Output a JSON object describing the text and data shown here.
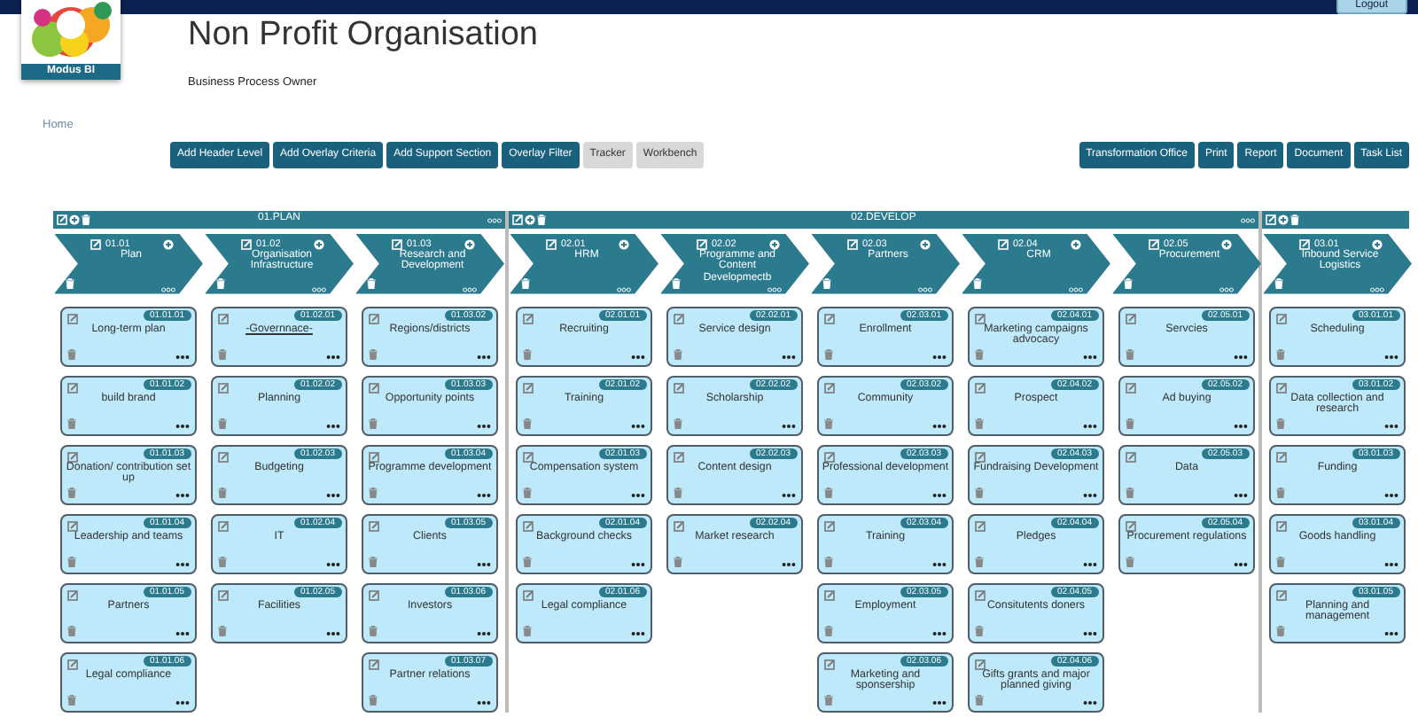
{
  "top_bar": {
    "logout_button": "Logout"
  },
  "logo": {
    "caption": "Modus BI"
  },
  "title": "Non Profit Organisation",
  "subtitle": "Business Process Owner",
  "breadcrumb": "Home",
  "toolbar_left": [
    {
      "label": "Add Header Level",
      "kind": "primary"
    },
    {
      "label": "Add Overlay Criteria",
      "kind": "primary"
    },
    {
      "label": "Add Support Section",
      "kind": "primary"
    },
    {
      "label": "Overlay Filter",
      "kind": "primary"
    },
    {
      "label": "Tracker",
      "kind": "secondary"
    },
    {
      "label": "Workbench",
      "kind": "secondary"
    }
  ],
  "toolbar_right": [
    {
      "label": "Transformation Office",
      "kind": "primary"
    },
    {
      "label": "Print",
      "kind": "primary"
    },
    {
      "label": "Report",
      "kind": "primary"
    },
    {
      "label": "Document",
      "kind": "primary"
    },
    {
      "label": "Task List",
      "kind": "primary"
    }
  ],
  "groups": [
    {
      "label": "01.PLAN",
      "columns": [
        {
          "code": "01.01",
          "title": "Plan",
          "cards": [
            {
              "code": "01.01.01",
              "title": "Long-term plan",
              "kind": "plain"
            },
            {
              "code": "01.01.02",
              "title": "build brand",
              "kind": "plain"
            },
            {
              "code": "01.01.03",
              "title": "Donation/ contribution set up",
              "kind": "plain"
            },
            {
              "code": "01.01.04",
              "title": "Leadership and teams",
              "kind": "plain"
            },
            {
              "code": "01.01.05",
              "title": "Partners",
              "kind": "plain"
            },
            {
              "code": "01.01.06",
              "title": "Legal compliance",
              "kind": "plain"
            }
          ]
        },
        {
          "code": "01.02",
          "title": "Organisation Infrastructure",
          "cards": [
            {
              "code": "01.02.01",
              "title": "-Governnace-",
              "kind": "link"
            },
            {
              "code": "01.02.02",
              "title": "Planning",
              "kind": "plain"
            },
            {
              "code": "01.02.03",
              "title": "Budgeting",
              "kind": "plain"
            },
            {
              "code": "01.02.04",
              "title": "IT",
              "kind": "plain"
            },
            {
              "code": "01.02.05",
              "title": "Facilities",
              "kind": "plain"
            }
          ]
        },
        {
          "code": "01.03",
          "title": "Research and Development",
          "cards": [
            {
              "code": "01.03.02",
              "title": "Regions/districts",
              "kind": "plain"
            },
            {
              "code": "01.03.03",
              "title": "Opportunity points",
              "kind": "plain"
            },
            {
              "code": "01.03.04",
              "title": "Programme development",
              "kind": "plain"
            },
            {
              "code": "01.03.05",
              "title": "Clients",
              "kind": "plain"
            },
            {
              "code": "01.03.06",
              "title": "Investors",
              "kind": "plain"
            },
            {
              "code": "01.03.07",
              "title": "Partner relations",
              "kind": "plain"
            }
          ]
        }
      ]
    },
    {
      "label": "02.DEVELOP",
      "columns": [
        {
          "code": "02.01",
          "title": "HRM",
          "cards": [
            {
              "code": "02.01.01",
              "title": "Recruiting",
              "kind": "plain"
            },
            {
              "code": "02.01.02",
              "title": "Training",
              "kind": "plain"
            },
            {
              "code": "02.01.03",
              "title": "Compensation system",
              "kind": "plain"
            },
            {
              "code": "02.01.04",
              "title": "Background checks",
              "kind": "plain"
            },
            {
              "code": "02.01.06",
              "title": "Legal compliance",
              "kind": "plain"
            }
          ]
        },
        {
          "code": "02.02",
          "title": "Programme and Content Developmectb",
          "cards": [
            {
              "code": "02.02.01",
              "title": "Service design",
              "kind": "plain"
            },
            {
              "code": "02.02.02",
              "title": "Scholarship",
              "kind": "plain"
            },
            {
              "code": "02.02.03",
              "title": "Content design",
              "kind": "plain"
            },
            {
              "code": "02.02.04",
              "title": "Market research",
              "kind": "plain"
            }
          ]
        },
        {
          "code": "02.03",
          "title": "Partners",
          "cards": [
            {
              "code": "02.03.01",
              "title": "Enrollment",
              "kind": "plain"
            },
            {
              "code": "02.03.02",
              "title": "Community",
              "kind": "plain"
            },
            {
              "code": "02.03.03",
              "title": "Professional development",
              "kind": "plain"
            },
            {
              "code": "02.03.04",
              "title": "Training",
              "kind": "plain"
            },
            {
              "code": "02.03.05",
              "title": "Employment",
              "kind": "plain"
            },
            {
              "code": "02.03.06",
              "title": "Marketing and sponsership",
              "kind": "plain"
            }
          ]
        },
        {
          "code": "02.04",
          "title": "CRM",
          "cards": [
            {
              "code": "02.04.01",
              "title": "Marketing campaigns advocacy",
              "kind": "plain"
            },
            {
              "code": "02.04.02",
              "title": "Prospect",
              "kind": "plain"
            },
            {
              "code": "02.04.03",
              "title": "Fundraising Development",
              "kind": "plain"
            },
            {
              "code": "02.04.04",
              "title": "Pledges",
              "kind": "plain"
            },
            {
              "code": "02.04.05",
              "title": "Consitutents doners",
              "kind": "plain"
            },
            {
              "code": "02.04.06",
              "title": "Gifts grants and major planned giving",
              "kind": "plain"
            }
          ]
        },
        {
          "code": "02.05",
          "title": "Procurement",
          "cards": [
            {
              "code": "02.05.01",
              "title": "Servcies",
              "kind": "plain"
            },
            {
              "code": "02.05.02",
              "title": "Ad buying",
              "kind": "plain"
            },
            {
              "code": "02.05.03",
              "title": "Data",
              "kind": "plain"
            },
            {
              "code": "02.05.04",
              "title": "Procurement regulations",
              "kind": "plain"
            }
          ]
        }
      ]
    },
    {
      "columns": [
        {
          "code": "03.01",
          "title": "Inbound Service Logistics",
          "cards": [
            {
              "code": "03.01.01",
              "title": "Scheduling",
              "kind": "plain"
            },
            {
              "code": "03.01.02",
              "title": "Data collection and research",
              "kind": "plain"
            },
            {
              "code": "03.01.03",
              "title": "Funding",
              "kind": "plain"
            },
            {
              "code": "03.01.04",
              "title": "Goods handling",
              "kind": "plain"
            },
            {
              "code": "03.01.05",
              "title": "Planning and management",
              "kind": "plain"
            }
          ]
        }
      ]
    }
  ]
}
